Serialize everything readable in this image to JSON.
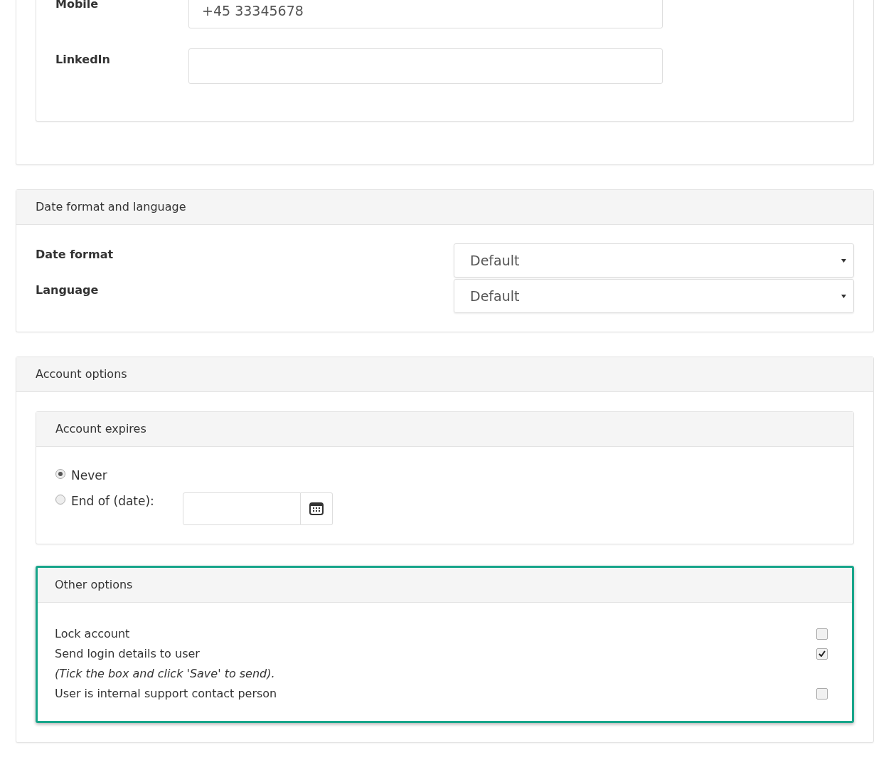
{
  "contact_fields": [
    {
      "label": "Mobile",
      "value": "+45 33345678"
    },
    {
      "label": "LinkedIn"
    }
  ],
  "date_format_and_language": {
    "title": "Date format and language",
    "fields": [
      {
        "label": "Date format",
        "value": "Default"
      },
      {
        "label": "Language",
        "value": "Default"
      }
    ]
  },
  "account_options": {
    "title": "Account options",
    "account_expires": {
      "title": "Account expires",
      "options": [
        {
          "label": "Never",
          "selected": true,
          "kind": "plain"
        },
        {
          "label": "End of (date):",
          "selected": false,
          "kind": "date"
        }
      ]
    },
    "other_options": {
      "title": "Other options",
      "highlighted": true,
      "rows": [
        {
          "kind": "checkbox",
          "label": "Lock account",
          "checked": false
        },
        {
          "kind": "checkbox",
          "label": "Send login details to user",
          "checked": true
        },
        {
          "kind": "note",
          "label": "(Tick the box and click 'Save' to send)."
        },
        {
          "kind": "checkbox",
          "label": "User is internal support contact person",
          "checked": false
        }
      ]
    }
  }
}
